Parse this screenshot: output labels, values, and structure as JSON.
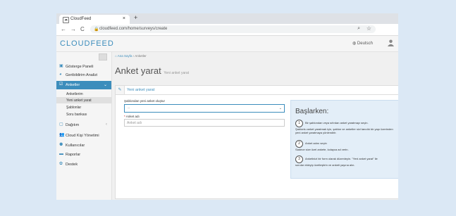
{
  "browser": {
    "tab_title": "CloudFeed",
    "tab_close": "×",
    "new_tab": "+",
    "url": "cloudfeed.com/home/surveys/create",
    "nav_back": "←",
    "nav_forward": "→",
    "nav_reload": "C"
  },
  "app": {
    "logo": "CLOUDFEED",
    "language": "Deutsch"
  },
  "sidebar": {
    "items": [
      {
        "label": "Gösterge Paneli",
        "icon": "dashboard-icon"
      },
      {
        "label": "Geribildirim Analizi",
        "icon": "analysis-icon"
      },
      {
        "label": "Anketler",
        "icon": "survey-icon"
      },
      {
        "label": "Dağıtım",
        "icon": "distribution-icon"
      },
      {
        "label": "Cloud Kişi Yönetimi",
        "icon": "contacts-icon"
      },
      {
        "label": "Kullanıcılar",
        "icon": "users-icon"
      },
      {
        "label": "Raporlar",
        "icon": "reports-icon"
      },
      {
        "label": "Destek",
        "icon": "support-icon"
      }
    ],
    "subitems": [
      "Anketlerim",
      "Yeni anket yarat",
      "Şablonlar",
      "Soru bankası"
    ]
  },
  "content": {
    "breadcrumb_home": "Ana Sayfa",
    "breadcrumb_sep": "›",
    "breadcrumb_current": "Anketler",
    "title": "Anket yarat",
    "subtitle": "Yeni anket yarat",
    "panel_title": "Yeni anket yarat",
    "select_label": "Şablondan yeni anket oluştur",
    "select_value": "--",
    "name_label": "Anket adı",
    "name_placeholder": "Anket adı"
  },
  "help": {
    "heading": "Başlarken:",
    "steps": [
      {
        "num": "1",
        "line1": "Bir şablondan veya sıfırdan anket yaratmayı seçin.",
        "line2": "Şablonlu anket yaratmak için, şablon ve anketler sizi tanıdık bir yapı üzerinden",
        "line3": "yeni anket yaratmaya yönlendirir."
      },
      {
        "num": "2",
        "line1": "Anket adını seçin",
        "line2": "Sadece size özel ankete, kolayca ad verin.",
        "line3": ""
      },
      {
        "num": "3",
        "line1": "Anketinizi bir form olarak düzenleyin. \"Yeni anket yarat\" ile",
        "line2": "sorular ekleyip özelleştirin ve anketi yayına alın.",
        "line3": ""
      }
    ]
  },
  "colors": {
    "accent": "#3c8dbc",
    "help_bg": "#e3eef8"
  }
}
